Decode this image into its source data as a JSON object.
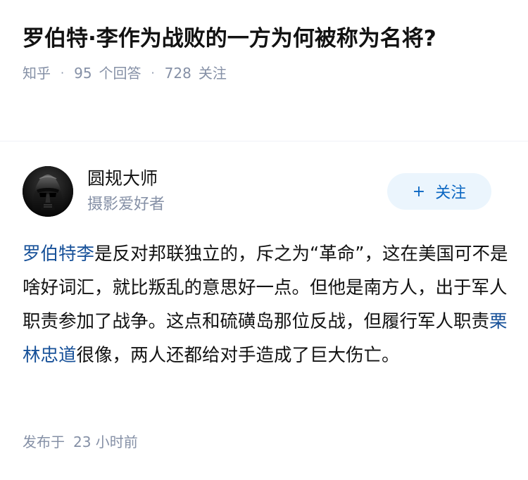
{
  "question": {
    "title": "罗伯特·李作为战败的一方为何被称为名将?",
    "source": "知乎",
    "answer_count": "95",
    "answer_label": "个回答",
    "follow_count": "728",
    "follow_label": "关注",
    "separator": "·"
  },
  "author": {
    "name": "圆规大师",
    "bio": "摄影爱好者",
    "follow_button_icon": "+",
    "follow_button_label": "关注",
    "avatar_icon": "darth-vader-avatar"
  },
  "answer": {
    "segments": [
      {
        "text": "罗伯特李",
        "link": true
      },
      {
        "text": "是反对邦联独立的，斥之为“革命”，这在美国可不是啥好词汇，就比叛乱的意思好一点。但他是南方人，出于军人职责参加了战争。这点和硫磺岛那位反战，但履行军人职责",
        "link": false
      },
      {
        "text": "栗林忠道",
        "link": true
      },
      {
        "text": "很像，两人还都给对手造成了巨大伤亡。",
        "link": false
      }
    ]
  },
  "footer": {
    "published_label": "发布于",
    "time": "23 小时前"
  },
  "colors": {
    "link": "#175199",
    "meta": "#8590a6",
    "follow_bg": "#ebf5fd",
    "follow_text": "#0a66c2"
  }
}
